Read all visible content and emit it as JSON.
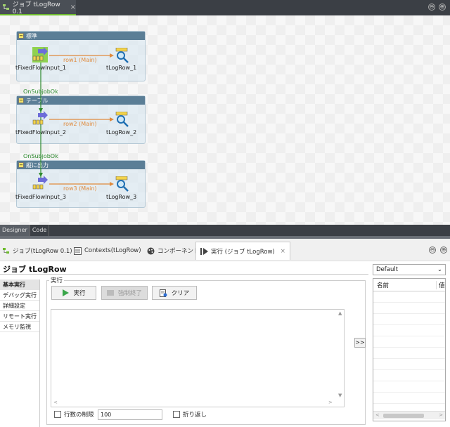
{
  "editor": {
    "tab_title": "ジョブ tLogRow 0.1",
    "close": "×"
  },
  "window_controls": {
    "minimize": "⊖",
    "maximize": "⊕"
  },
  "canvas": {
    "subjobs": [
      {
        "title": "標準",
        "input": "tFixedFlowInput_1",
        "output": "tLogRow_1",
        "row": "row1 (Main)"
      },
      {
        "title": "テーブル",
        "input": "tFixedFlowInput_2",
        "output": "tLogRow_2",
        "row": "row2 (Main)"
      },
      {
        "title": "縦に出力",
        "input": "tFixedFlowInput_3",
        "output": "tLogRow_3",
        "row": "row3 (Main)"
      }
    ],
    "triggers": [
      "OnSubjobOk",
      "OnSubjobOk"
    ]
  },
  "bottom_tabs": [
    "Designer",
    "Code"
  ],
  "views": {
    "tabs": [
      "ジョブ(tLogRow 0.1)",
      "Contexts(tLogRow)",
      "コンポーネント",
      "実行 (ジョブ tLogRow)"
    ],
    "close": "×"
  },
  "run": {
    "job_title": "ジョブ tLogRow",
    "nav": [
      "基本実行",
      "デバッグ実行",
      "詳細設定",
      "リモート実行",
      "メモリ監視"
    ],
    "group_label": "実行",
    "run_button": "実行",
    "kill_button": "強制終了",
    "clear_button": "クリア",
    "limit_label": "行数の制限",
    "limit_value": "100",
    "wrap_label": "折り返し",
    "arrow_button": ">>"
  },
  "context": {
    "selected": "Default",
    "columns": [
      "名前",
      "値"
    ]
  },
  "colors": {
    "accent": "#6dbb2c",
    "row_link": "#e08a3c",
    "trigger": "#2d8a2d",
    "subjob_header": "#5b7e96"
  }
}
